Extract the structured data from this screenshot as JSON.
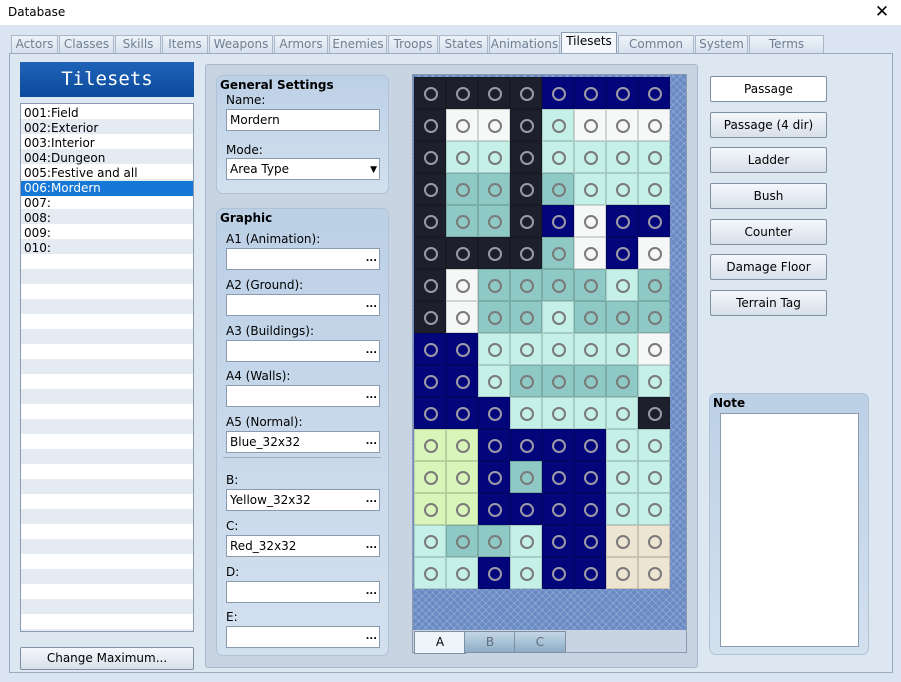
{
  "window": {
    "title": "Database",
    "close": "✕"
  },
  "tabs": [
    "Actors",
    "Classes",
    "Skills",
    "Items",
    "Weapons",
    "Armors",
    "Enemies",
    "Troops",
    "States",
    "Animations",
    "Tilesets",
    "Common Events",
    "System",
    "Terms"
  ],
  "selected_tab": "Tilesets",
  "sidebar": {
    "header": "Tilesets",
    "items": [
      "001:Field",
      "002:Exterior",
      "003:Interior",
      "004:Dungeon",
      "005:Festive and all",
      "006:Mordern",
      "007:",
      "008:",
      "009:",
      "010:"
    ],
    "selected_index": 5,
    "change_max_label": "Change Maximum..."
  },
  "general": {
    "title": "General Settings",
    "name_label": "Name:",
    "name_value": "Mordern",
    "mode_label": "Mode:",
    "mode_value": "Area Type"
  },
  "graphic": {
    "title": "Graphic",
    "fields": [
      {
        "label": "A1 (Animation):",
        "value": ""
      },
      {
        "label": "A2 (Ground):",
        "value": ""
      },
      {
        "label": "A3 (Buildings):",
        "value": ""
      },
      {
        "label": "A4 (Walls):",
        "value": ""
      },
      {
        "label": "A5 (Normal):",
        "value": "Blue_32x32"
      },
      {
        "label": "B:",
        "value": "Yellow_32x32"
      },
      {
        "label": "C:",
        "value": "Red_32x32"
      },
      {
        "label": "D:",
        "value": ""
      },
      {
        "label": "E:",
        "value": ""
      }
    ],
    "browse": "..."
  },
  "tile_tabs": [
    "A",
    "B",
    "C"
  ],
  "selected_tile_tab": "A",
  "modes": [
    "Passage",
    "Passage (4 dir)",
    "Ladder",
    "Bush",
    "Counter",
    "Damage Floor",
    "Terrain Tag"
  ],
  "selected_mode": "Passage",
  "note": {
    "title": "Note",
    "value": ""
  },
  "tile_colors": {
    "K": "#1e1f2c",
    "N": "#03057a",
    "W": "#f6f8f8",
    "C": "#c4f0e8",
    "T": "#8fc9c5",
    "G": "#d9f5b9",
    "B": "#eee4d2"
  }
}
